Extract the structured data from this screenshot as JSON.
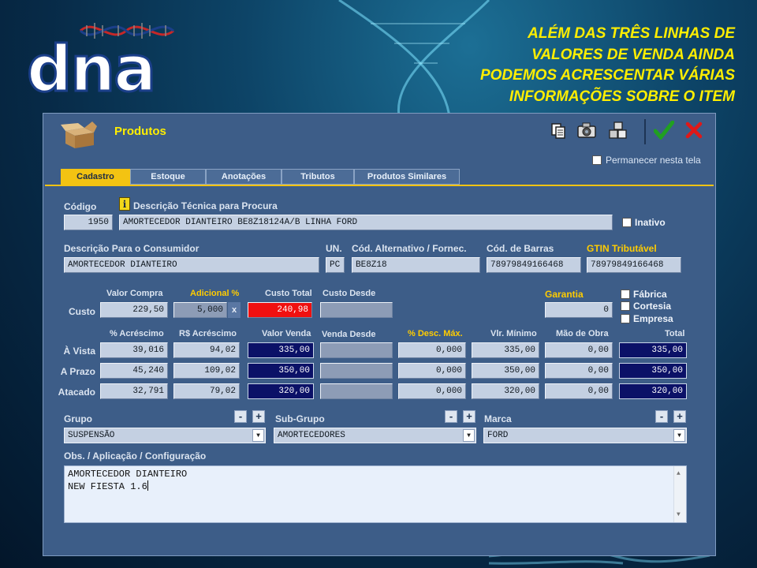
{
  "brand": {
    "logo_text": "dna"
  },
  "headline": [
    "ALÉM DAS TRÊS LINHAS DE",
    "VALORES DE VENDA AINDA",
    "PODEMOS ACRESCENTAR VÁRIAS",
    "INFORMAÇÕES SOBRE O ITEM"
  ],
  "window": {
    "title": "Produtos",
    "toolbar": {
      "icons": [
        "copy-icon",
        "camera-icon",
        "boxes-icon",
        "confirm-check-icon",
        "cancel-x-icon"
      ],
      "confirm_color": "#20a020",
      "cancel_color": "#e01818"
    },
    "keep_on_screen": "Permanecer nesta tela",
    "tabs": [
      "Cadastro",
      "Estoque",
      "Anotações",
      "Tributos",
      "Produtos Similares"
    ],
    "active_tab": "Cadastro"
  },
  "form": {
    "codigo_label": "Código",
    "codigo": "1950",
    "desc_tecnica_label": "Descrição Técnica para Procura",
    "desc_tecnica": "AMORTECEDOR DIANTEIRO BE8Z18124A/B LINHA FORD",
    "inativo_label": "Inativo",
    "desc_consumidor_label": "Descrição Para o Consumidor",
    "desc_consumidor": "AMORTECEDOR DIANTEIRO",
    "un_label": "UN.",
    "un": "PC",
    "cod_alt_label": "Cód. Alternativo / Fornec.",
    "cod_alt": "BE8Z18",
    "cod_barras_label": "Cód. de Barras",
    "cod_barras": "78979849166468",
    "gtin_label": "GTIN Tributável",
    "gtin": "78979849166468",
    "cost": {
      "row_label": "Custo",
      "valor_compra_label": "Valor Compra",
      "valor_compra": "229,50",
      "adicional_label": "Adicional %",
      "adicional": "5,000",
      "x_label": "x",
      "custo_total_label": "Custo Total",
      "custo_total": "240,98",
      "custo_desde_label": "Custo Desde",
      "custo_desde": ""
    },
    "garantia_label": "Garantia",
    "garantia": "0",
    "garantia_options": [
      "Fábrica",
      "Cortesia",
      "Empresa"
    ],
    "price_columns": [
      "% Acréscimo",
      "R$ Acréscimo",
      "Valor Venda",
      "Venda Desde",
      "% Desc. Máx.",
      "Vlr. Mínimo",
      "Mão de Obra",
      "Total"
    ],
    "price_rows": [
      {
        "label": "À Vista",
        "acrescimo_pct": "39,016",
        "acrescimo_rs": "94,02",
        "valor_venda": "335,00",
        "venda_desde": "",
        "desc_max": "0,000",
        "vlr_minimo": "335,00",
        "mao_obra": "0,00",
        "total": "335,00"
      },
      {
        "label": "A Prazo",
        "acrescimo_pct": "45,240",
        "acrescimo_rs": "109,02",
        "valor_venda": "350,00",
        "venda_desde": "",
        "desc_max": "0,000",
        "vlr_minimo": "350,00",
        "mao_obra": "0,00",
        "total": "350,00"
      },
      {
        "label": "Atacado",
        "acrescimo_pct": "32,791",
        "acrescimo_rs": "79,02",
        "valor_venda": "320,00",
        "venda_desde": "",
        "desc_max": "0,000",
        "vlr_minimo": "320,00",
        "mao_obra": "0,00",
        "total": "320,00"
      }
    ],
    "grupo_label": "Grupo",
    "grupo": "SUSPENSÃO",
    "subgrupo_label": "Sub-Grupo",
    "subgrupo": "AMORTECEDORES",
    "marca_label": "Marca",
    "marca": "FORD",
    "minus": "-",
    "plus": "+",
    "obs_label": "Obs. / Aplicação / Configuração",
    "obs_lines": [
      "AMORTECEDOR DIANTEIRO",
      "NEW FIESTA 1.6"
    ]
  }
}
